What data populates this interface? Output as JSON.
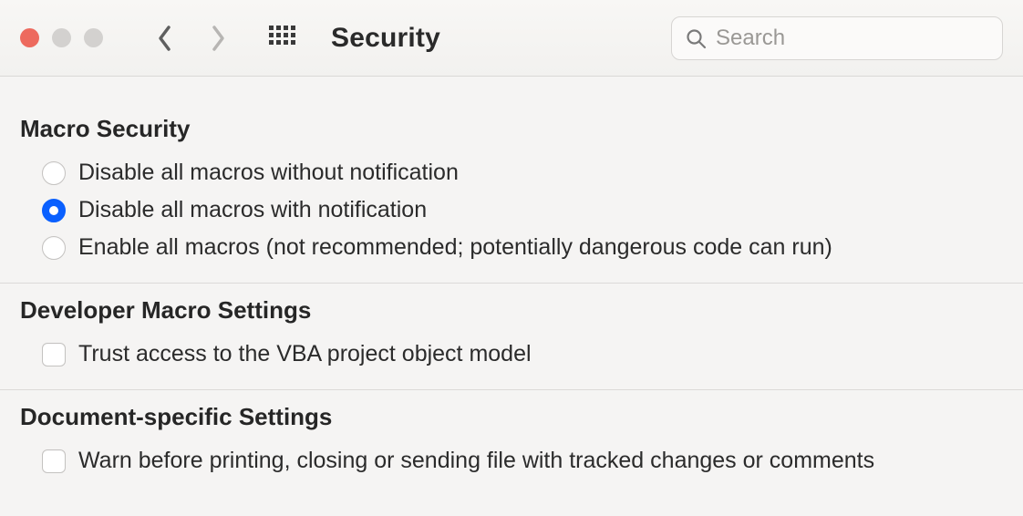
{
  "toolbar": {
    "title": "Security",
    "search_placeholder": "Search"
  },
  "sections": {
    "macro_security": {
      "title": "Macro Security",
      "options": [
        {
          "label": "Disable all macros without notification",
          "checked": false
        },
        {
          "label": "Disable all macros with notification",
          "checked": true
        },
        {
          "label": "Enable all macros (not recommended; potentially dangerous code can run)",
          "checked": false
        }
      ]
    },
    "developer": {
      "title": "Developer Macro Settings",
      "options": [
        {
          "label": "Trust access to the VBA project object model",
          "checked": false
        }
      ]
    },
    "document_specific": {
      "title": "Document-specific Settings",
      "options": [
        {
          "label": "Warn before printing, closing or sending file with tracked changes or comments",
          "checked": false
        }
      ]
    }
  }
}
